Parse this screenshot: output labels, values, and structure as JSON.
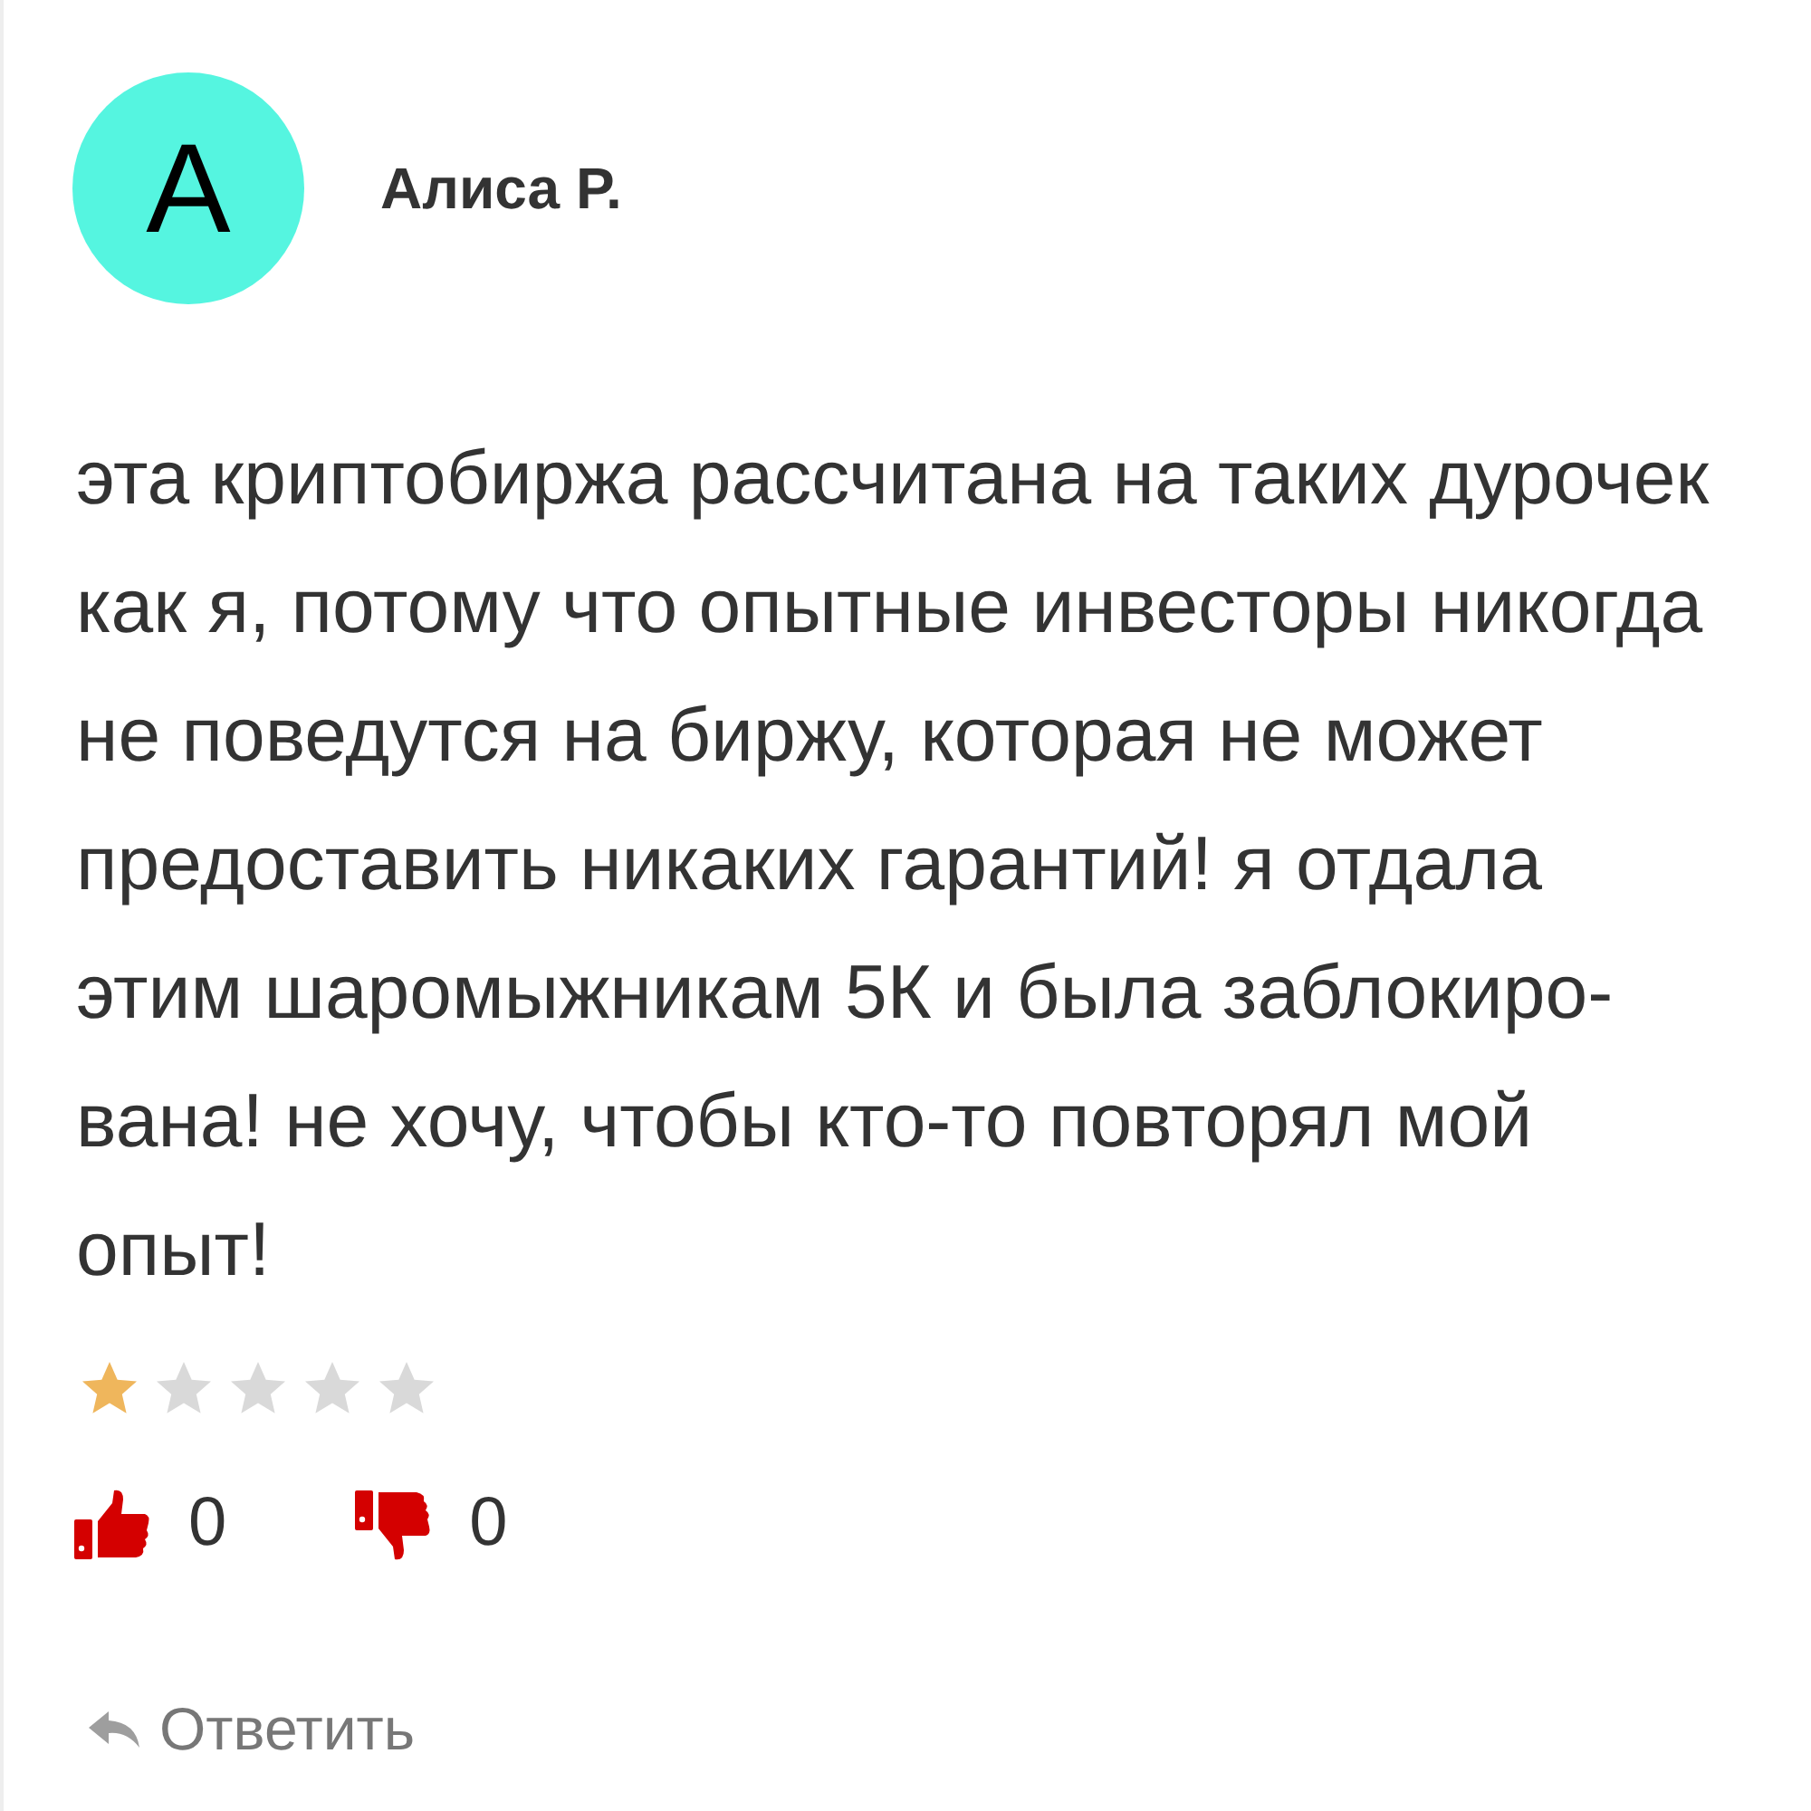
{
  "review": {
    "avatar_letter": "А",
    "author": "Алиса Р.",
    "text": "эта криптобиржа рассчитана на таких дурочек\nкак я, потому что опытные инвесторы никогда\nне поведутся на биржу, которая не может\nпредоставить никаких гарантий! я отдала\nэтим шаромыжникам 5К и была заблокиро-\nвана! не хочу, чтобы кто-то повторял мой\nопыт!",
    "stars": 1,
    "likes": "0",
    "dislikes": "0",
    "reply": "Ответить"
  }
}
